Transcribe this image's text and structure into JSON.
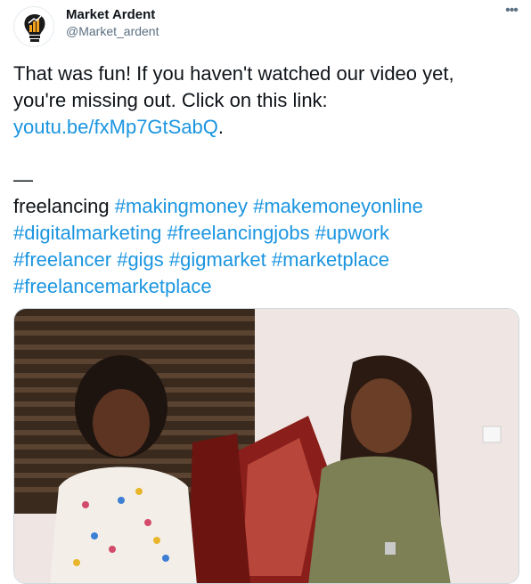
{
  "author": {
    "name": "Market Ardent",
    "handle": "@Market_ardent",
    "avatar_icon": "lightbulb-logo-icon"
  },
  "more_icon": "more-options-icon",
  "tweet": {
    "line1": "That was fun! If you haven't watched our video yet,",
    "line2": "you're missing out. Click on this link:",
    "link": "youtu.be/fxMp7GtSabQ",
    "link_suffix": ".",
    "dash": "—",
    "word": "freelancing",
    "hashtags": [
      "#makingmoney",
      "#makemoneyonline",
      "#digitalmarketing",
      "#freelancingjobs",
      "#upwork",
      "#freelancer",
      "#gigs",
      "#gigmarket",
      "#marketplace",
      "#freelancemarketplace"
    ]
  },
  "media": {
    "type": "video-thumbnail",
    "description_icon": "video-frame"
  },
  "colors": {
    "link": "#1b95e0",
    "text": "#0f1419",
    "secondary": "#5b7083"
  }
}
